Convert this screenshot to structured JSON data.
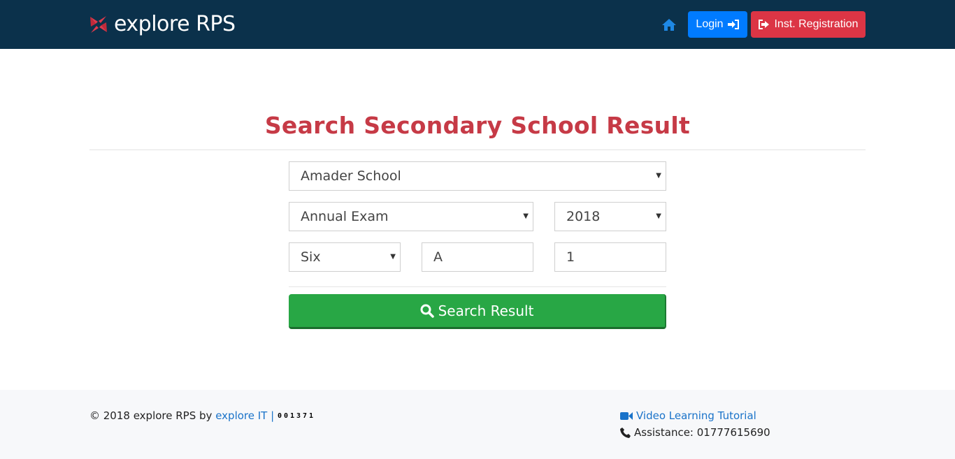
{
  "colors": {
    "navbar": "#0b314b",
    "brand_accent": "#e03a4c",
    "title": "#c63a46",
    "login_button": "#007bff",
    "registration_button": "#dc3545",
    "search_button": "#28a745",
    "link": "#1a73c9"
  },
  "navbar": {
    "brand": "explore RPS",
    "brand_icon": "explore-logo-icon",
    "home_icon": "home-icon",
    "login_label": "Login",
    "login_icon": "sign-in-icon",
    "registration_label": "Inst. Registration",
    "registration_icon": "sign-out-icon"
  },
  "main": {
    "title": "Search Secondary School Result",
    "form": {
      "school": "Amader School",
      "exam": "Annual Exam",
      "year": "2018",
      "class": "Six",
      "section": "A",
      "roll": "1"
    },
    "search_button": {
      "label": "Search Result",
      "icon": "search-icon"
    }
  },
  "footer": {
    "copyright_text": "© 2018 explore RPS by",
    "company_link": "explore IT |",
    "visitor_counter": "001371",
    "video_link": "Video Learning Tutorial",
    "video_icon": "video-camera-icon",
    "assistance": "Assistance: 01777615690",
    "phone_icon": "phone-icon"
  }
}
